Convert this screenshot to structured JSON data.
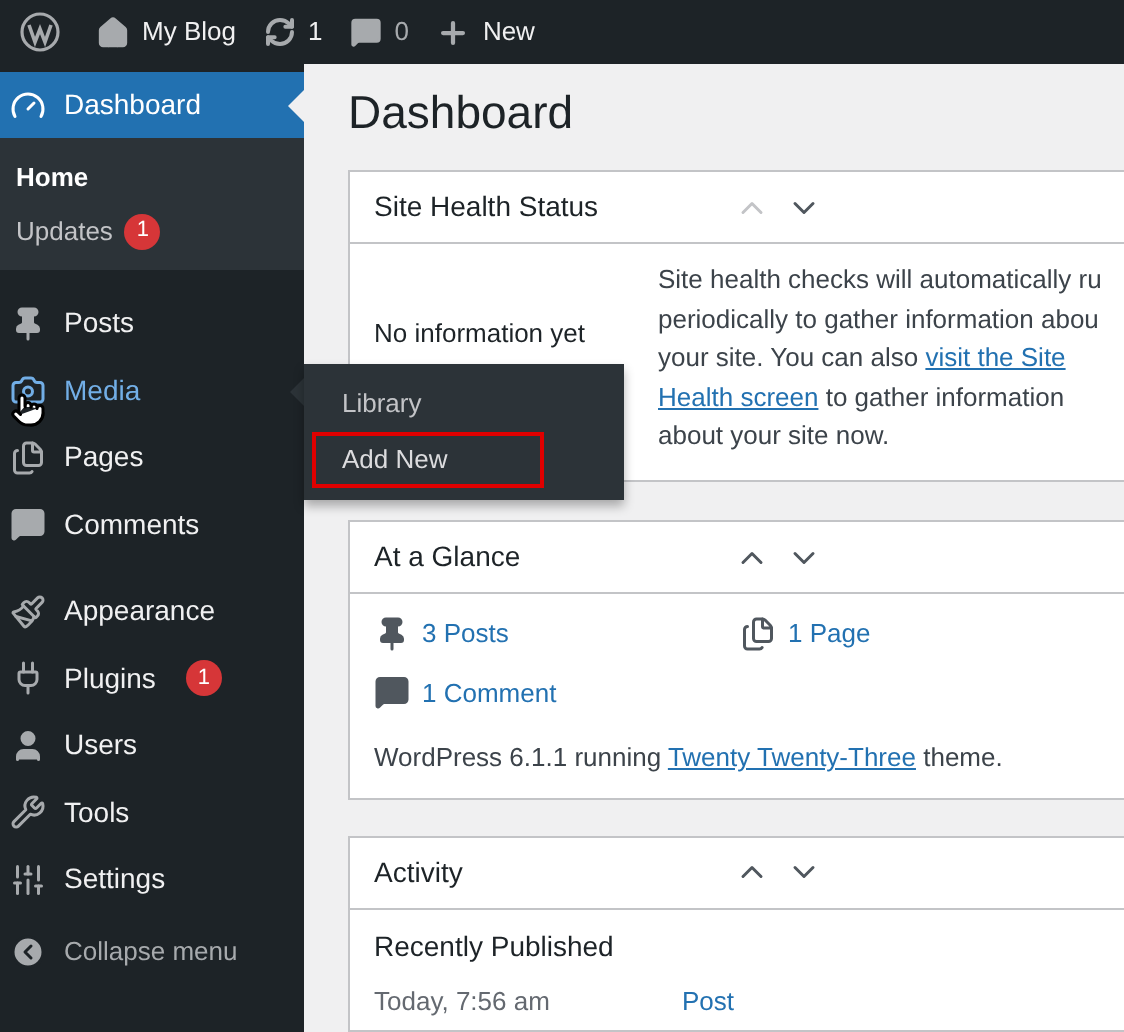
{
  "admin_bar": {
    "items": [
      {
        "kind": "logo"
      },
      {
        "kind": "site",
        "label": "My Blog"
      },
      {
        "kind": "updates",
        "label": "1"
      },
      {
        "kind": "comments",
        "label": "0"
      },
      {
        "kind": "new",
        "label": "New"
      }
    ]
  },
  "sidebar": {
    "current": {
      "kind": "dashboard",
      "label": "Dashboard",
      "submenu": [
        {
          "label": "Home",
          "selected": true
        },
        {
          "label": "Updates",
          "badge": "1",
          "selected": false
        }
      ]
    },
    "groups": [
      [
        {
          "kind": "posts",
          "label": "Posts",
          "hovered": false
        },
        {
          "kind": "media",
          "label": "Media",
          "hovered": true
        },
        {
          "kind": "pages",
          "label": "Pages",
          "hovered": false
        },
        {
          "kind": "comments",
          "label": "Comments",
          "hovered": false
        }
      ],
      [
        {
          "kind": "appearance",
          "label": "Appearance",
          "hovered": false
        },
        {
          "kind": "plugins",
          "label": "Plugins",
          "badge": "1",
          "hovered": false
        },
        {
          "kind": "users",
          "label": "Users",
          "hovered": false
        },
        {
          "kind": "tools",
          "label": "Tools",
          "hovered": false
        },
        {
          "kind": "settings",
          "label": "Settings",
          "hovered": false
        }
      ]
    ],
    "collapse": "Collapse menu"
  },
  "flyout": {
    "items": [
      {
        "label": "Library",
        "highlighted": false
      },
      {
        "label": "Add New",
        "highlighted": true
      }
    ]
  },
  "page_title": "Dashboard",
  "site_health": {
    "title": "Site Health Status",
    "move_up_disabled": true,
    "status": "No information yet",
    "description": [
      [
        {
          "text": "Site health checks will automatically ru"
        }
      ],
      [
        {
          "text": "periodically to gather information abou"
        }
      ],
      [
        {
          "text": "your site. You can also "
        },
        {
          "link": "visit the Site"
        }
      ],
      [
        {
          "link": "Health screen"
        },
        {
          "text": " to gather information"
        }
      ],
      [
        {
          "text": "about your site now."
        }
      ]
    ]
  },
  "at_a_glance": {
    "title": "At a Glance",
    "move_up_disabled": false,
    "items": [
      {
        "kind": "posts",
        "label": "3 Posts"
      },
      {
        "kind": "pages",
        "label": "1 Page"
      },
      {
        "kind": "comments",
        "label": "1 Comment"
      }
    ],
    "footer_before": "WordPress 6.1.1 running ",
    "footer_link": "Twenty Twenty-Three",
    "footer_after": " theme."
  },
  "activity": {
    "title": "Activity",
    "move_up_disabled": false,
    "section": "Recently Published",
    "rows": [
      {
        "date": "Today, 7:56 am",
        "title": "Post"
      }
    ]
  }
}
